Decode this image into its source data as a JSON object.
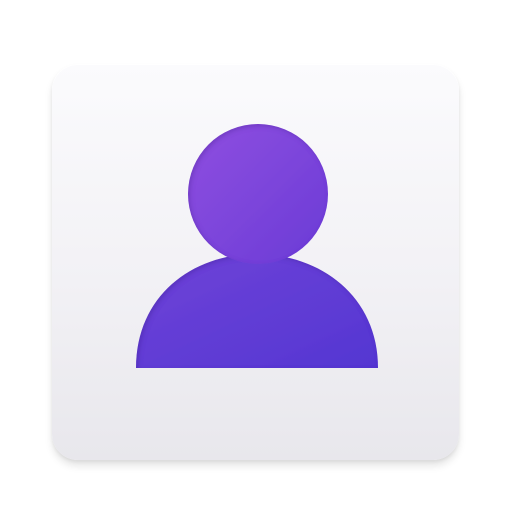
{
  "app_icon": {
    "icon": "user-profile-icon",
    "colors": {
      "tile_top": "#fbfbfd",
      "tile_bottom": "#e8e7ec",
      "figure_light": "#8e4ddd",
      "figure_dark": "#5a37d4"
    }
  }
}
